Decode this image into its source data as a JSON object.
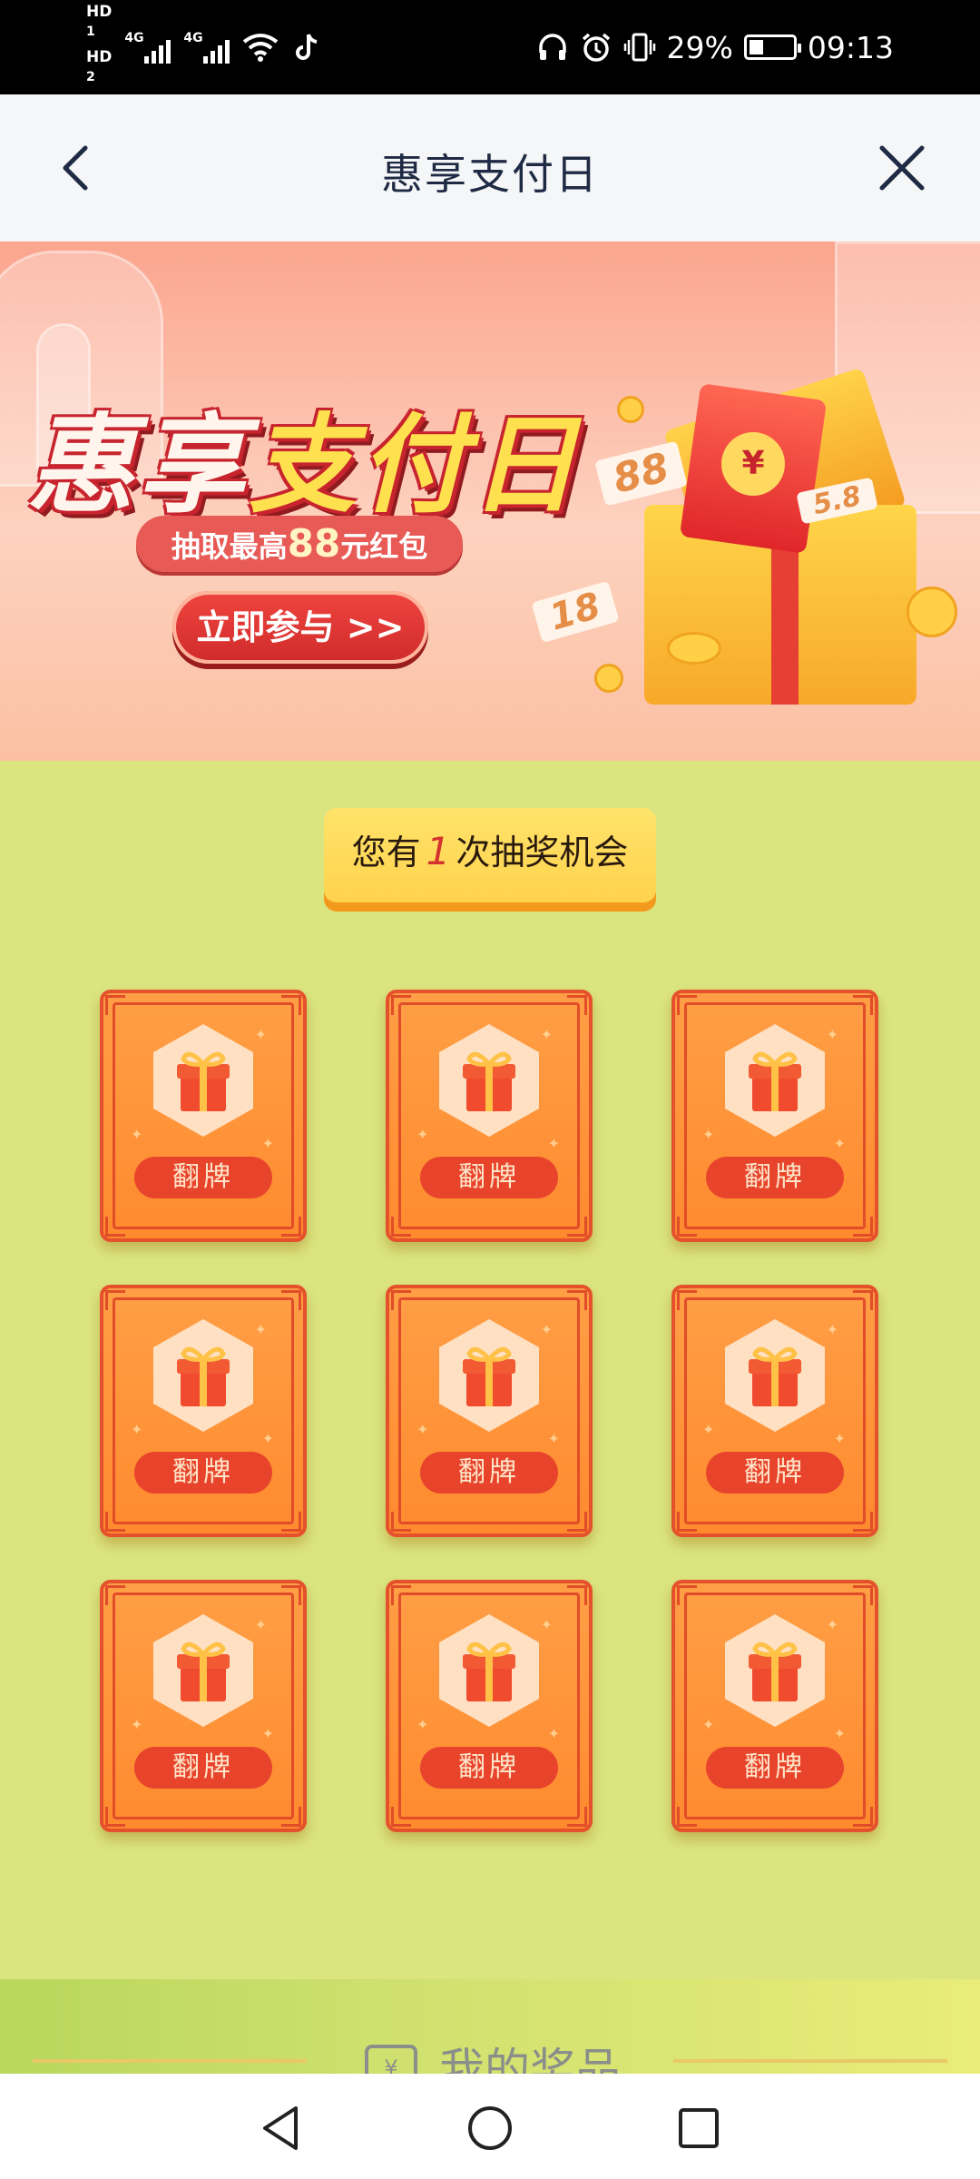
{
  "status_bar": {
    "hd1": "HD",
    "hd1_sub": "1",
    "hd2": "HD",
    "hd2_sub": "2",
    "net1": "4G",
    "net2": "4G",
    "battery": "29%",
    "time": "09:13"
  },
  "nav": {
    "title": "惠享支付日"
  },
  "banner": {
    "title_part1": "惠享",
    "title_part2": "支付日",
    "subtitle_prefix": "抽取最高",
    "subtitle_amount": "88",
    "subtitle_suffix": "元红包",
    "cta": "立即参与 >>",
    "ticket_88": "88",
    "ticket_58": "5.8",
    "ticket_18": "18",
    "coin_symbol": "¥"
  },
  "chance": {
    "prefix": "您有",
    "count": "1",
    "suffix": "次抽奖机会"
  },
  "cards": [
    {
      "label": "翻牌"
    },
    {
      "label": "翻牌"
    },
    {
      "label": "翻牌"
    },
    {
      "label": "翻牌"
    },
    {
      "label": "翻牌"
    },
    {
      "label": "翻牌"
    },
    {
      "label": "翻牌"
    },
    {
      "label": "翻牌"
    },
    {
      "label": "翻牌"
    }
  ],
  "prizes": {
    "label": "我的奖品"
  },
  "colors": {
    "page_bg": "#dbe57f",
    "card_orange": "#ff8a2e",
    "flip_button": "#e8442c",
    "chance_yellow": "#ffd24c"
  }
}
